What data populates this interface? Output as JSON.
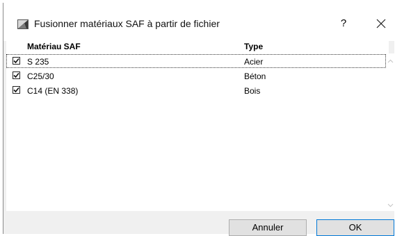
{
  "window": {
    "title": "Fusionner matériaux SAF à partir de fichier",
    "help_label": "?",
    "icon": "app-material-icon",
    "close_icon": "close-icon"
  },
  "table": {
    "columns": [
      "Matériau SAF",
      "Type"
    ],
    "rows": [
      {
        "checked": true,
        "name": "S 235",
        "type": "Acier"
      },
      {
        "checked": true,
        "name": "C25/30",
        "type": "Béton"
      },
      {
        "checked": true,
        "name": "C14 (EN 338)",
        "type": "Bois"
      }
    ]
  },
  "buttons": {
    "cancel_label": "Annuler",
    "ok_label": "OK"
  },
  "colors": {
    "accent": "#0078d7",
    "dialog_bg": "#f0f0f0"
  }
}
